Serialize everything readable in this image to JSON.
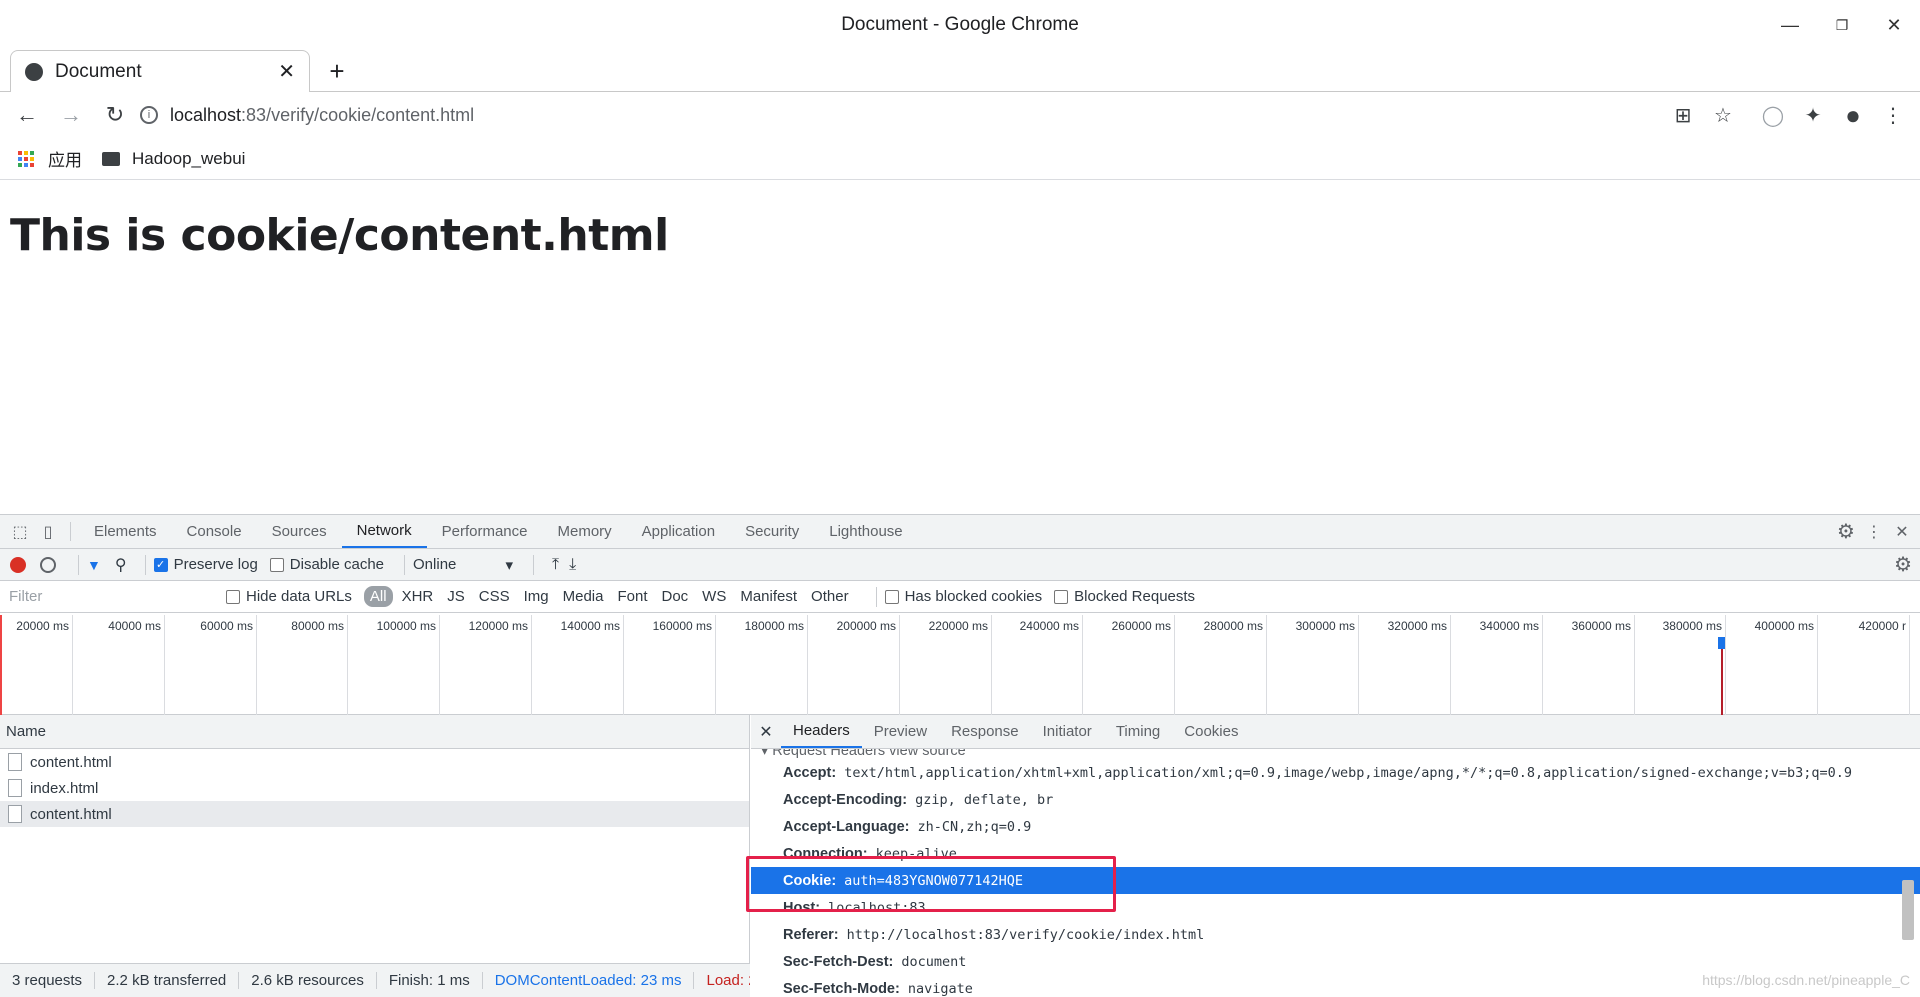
{
  "window": {
    "title": "Document - Google Chrome",
    "min": "—",
    "max": "❐",
    "close": "✕"
  },
  "tab": {
    "title": "Document",
    "close": "✕",
    "newtab": "+"
  },
  "toolbar": {
    "back": "←",
    "forward": "→",
    "reload": "↻",
    "url_host": "localhost",
    "url_path": ":83/verify/cookie/content.html",
    "info": "i",
    "translate": "⊞",
    "star": "☆",
    "ext_circle": "◯",
    "puzzle": "✦",
    "profile": "●",
    "menu": "⋮"
  },
  "bookmarks": {
    "apps": "应用",
    "folder": "Hadoop_webui"
  },
  "page": {
    "heading": "This is cookie/content.html"
  },
  "devtools": {
    "tabs": [
      "Elements",
      "Console",
      "Sources",
      "Network",
      "Performance",
      "Memory",
      "Application",
      "Security",
      "Lighthouse"
    ],
    "active_tab": "Network",
    "gear": "⚙",
    "more": "⋮",
    "close": "✕",
    "network_toolbar": {
      "preserve_log": "Preserve log",
      "disable_cache": "Disable cache",
      "throttle": "Online",
      "throttle_arrow": "▾",
      "upload": "⤒",
      "download": "⤓",
      "filter_icon": "▼",
      "search_icon": "⚲"
    },
    "filter": {
      "placeholder": "Filter",
      "hide_data_urls": "Hide data URLs",
      "types": [
        "All",
        "XHR",
        "JS",
        "CSS",
        "Img",
        "Media",
        "Font",
        "Doc",
        "WS",
        "Manifest",
        "Other"
      ],
      "has_blocked_cookies": "Has blocked cookies",
      "blocked_requests": "Blocked Requests"
    },
    "timeline_ticks": [
      "20000 ms",
      "40000 ms",
      "60000 ms",
      "80000 ms",
      "100000 ms",
      "120000 ms",
      "140000 ms",
      "160000 ms",
      "180000 ms",
      "200000 ms",
      "220000 ms",
      "240000 ms",
      "260000 ms",
      "280000 ms",
      "300000 ms",
      "320000 ms",
      "340000 ms",
      "360000 ms",
      "380000 ms",
      "400000 ms",
      "420000 r"
    ],
    "names_header": "Name",
    "requests": [
      "content.html",
      "index.html",
      "content.html"
    ],
    "status_bar": [
      "3 requests",
      "2.2 kB transferred",
      "2.6 kB resources",
      "Finish: 1 ms",
      "DOMContentLoaded: 23 ms",
      "Load: 2"
    ],
    "detail_tabs": [
      "Headers",
      "Preview",
      "Response",
      "Initiator",
      "Timing",
      "Cookies"
    ],
    "detail_close": "✕",
    "section_partial": "▾ Request Headers      view source",
    "headers": [
      {
        "k": "Accept:",
        "v": "text/html,application/xhtml+xml,application/xml;q=0.9,image/webp,image/apng,*/*;q=0.8,application/signed-exchange;v=b3;q=0.9"
      },
      {
        "k": "Accept-Encoding:",
        "v": "gzip, deflate, br"
      },
      {
        "k": "Accept-Language:",
        "v": "zh-CN,zh;q=0.9"
      },
      {
        "k": "Connection:",
        "v": "keep-alive"
      },
      {
        "k": "Cookie:",
        "v": "auth=483YGNOW077142HQE"
      },
      {
        "k": "Host:",
        "v": "localhost:83"
      },
      {
        "k": "Referer:",
        "v": "http://localhost:83/verify/cookie/index.html"
      },
      {
        "k": "Sec-Fetch-Dest:",
        "v": "document"
      },
      {
        "k": "Sec-Fetch-Mode:",
        "v": "navigate"
      }
    ],
    "selected_header_index": 4
  },
  "watermark": "https://blog.csdn.net/pineapple_C",
  "colors": {
    "accent": "#1a73e8",
    "record": "#d93025",
    "highlight": "#e4204a"
  }
}
